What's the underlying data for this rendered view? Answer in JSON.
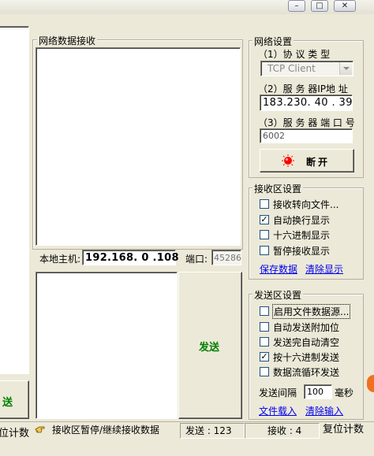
{
  "window": {
    "minimize_glyph": "–",
    "maximize_glyph": "□",
    "close_glyph": "✕"
  },
  "receive_panel": {
    "title": "网络数据接收",
    "content": ""
  },
  "local_host": {
    "label": "本地主机:",
    "ip": "192.168. 0 .108",
    "port_label": "端口:",
    "port": "45286"
  },
  "send_panel": {
    "content": "",
    "send_button": "发送"
  },
  "left_clipped": {
    "button_text": "送",
    "reset_text": "位计数"
  },
  "network": {
    "title": "网络设置",
    "protocol_label": "（1）协 议 类 型",
    "protocol_value": "TCP Client",
    "ip_label": "（2）服 务 器IP地 址",
    "ip_value": "183.230. 40 . 39",
    "port_label": "（3）服 务 器 端 口 号",
    "port_value": "6002",
    "disconnect_button": "断开",
    "status_color": "#ff0000"
  },
  "receive_settings": {
    "title": "接收区设置",
    "options": [
      {
        "label": "接收转向文件...",
        "checked": false
      },
      {
        "label": "自动换行显示",
        "checked": true
      },
      {
        "label": "十六进制显示",
        "checked": false
      },
      {
        "label": "暂停接收显示",
        "checked": false
      }
    ],
    "save_link": "保存数据",
    "clear_link": "清除显示"
  },
  "send_settings": {
    "title": "发送区设置",
    "options": [
      {
        "label": "启用文件数据源...",
        "checked": false
      },
      {
        "label": "自动发送附加位",
        "checked": false
      },
      {
        "label": "发送完自动清空",
        "checked": false
      },
      {
        "label": "按十六进制发送",
        "checked": true
      },
      {
        "label": "数据流循环发送",
        "checked": false
      }
    ],
    "interval_label": "发送间隔",
    "interval_value": "100",
    "interval_unit": "毫秒",
    "load_file_link": "文件载入",
    "clear_input_link": "清除输入"
  },
  "status_bar": {
    "hint": "接收区暂停/继续接收数据",
    "sent": "发送 : 123",
    "received": "接收 : 4",
    "reset": "复位计数"
  }
}
